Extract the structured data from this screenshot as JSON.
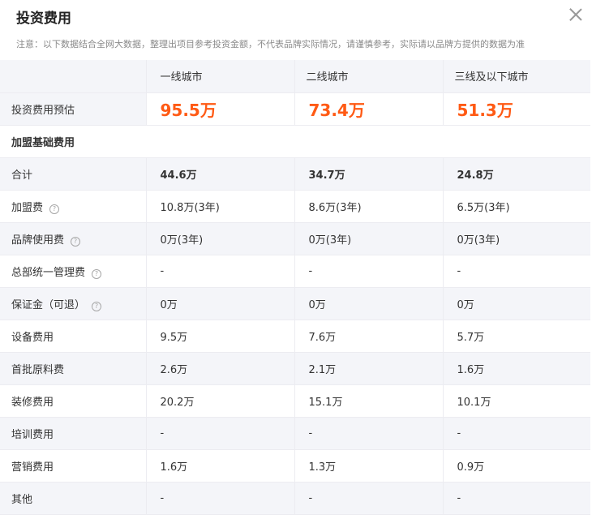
{
  "header": {
    "title": "投资费用",
    "notice": "注意：以下数据结合全网大数据，整理出项目参考投资金额，不代表品牌实际情况，请谨慎参考，实际请以品牌方提供的数据为准"
  },
  "table": {
    "columns": [
      "一线城市",
      "二线城市",
      "三线及以下城市"
    ],
    "estimate": {
      "label": "投资费用预估",
      "values": [
        "95.5万",
        "73.4万",
        "51.3万"
      ]
    },
    "section_label": "加盟基础费用",
    "rows": [
      {
        "label": "合计",
        "values": [
          "44.6万",
          "34.7万",
          "24.8万"
        ],
        "help": false
      },
      {
        "label": "加盟费",
        "values": [
          "10.8万(3年)",
          "8.6万(3年)",
          "6.5万(3年)"
        ],
        "help": true
      },
      {
        "label": "品牌使用费",
        "values": [
          "0万(3年)",
          "0万(3年)",
          "0万(3年)"
        ],
        "help": true
      },
      {
        "label": "总部统一管理费",
        "values": [
          "-",
          "-",
          "-"
        ],
        "help": true
      },
      {
        "label": "保证金（可退）",
        "values": [
          "0万",
          "0万",
          "0万"
        ],
        "help": true
      },
      {
        "label": "设备费用",
        "values": [
          "9.5万",
          "7.6万",
          "5.7万"
        ],
        "help": false
      },
      {
        "label": "首批原料费",
        "values": [
          "2.6万",
          "2.1万",
          "1.6万"
        ],
        "help": false
      },
      {
        "label": "装修费用",
        "values": [
          "20.2万",
          "15.1万",
          "10.1万"
        ],
        "help": false
      },
      {
        "label": "培训费用",
        "values": [
          "-",
          "-",
          "-"
        ],
        "help": false
      },
      {
        "label": "营销费用",
        "values": [
          "1.6万",
          "1.3万",
          "0.9万"
        ],
        "help": false
      },
      {
        "label": "其他",
        "values": [
          "-",
          "-",
          "-"
        ],
        "help": false
      }
    ],
    "help_glyph": "?"
  },
  "icons": {
    "close": "close-icon",
    "help": "help-circle-icon"
  }
}
